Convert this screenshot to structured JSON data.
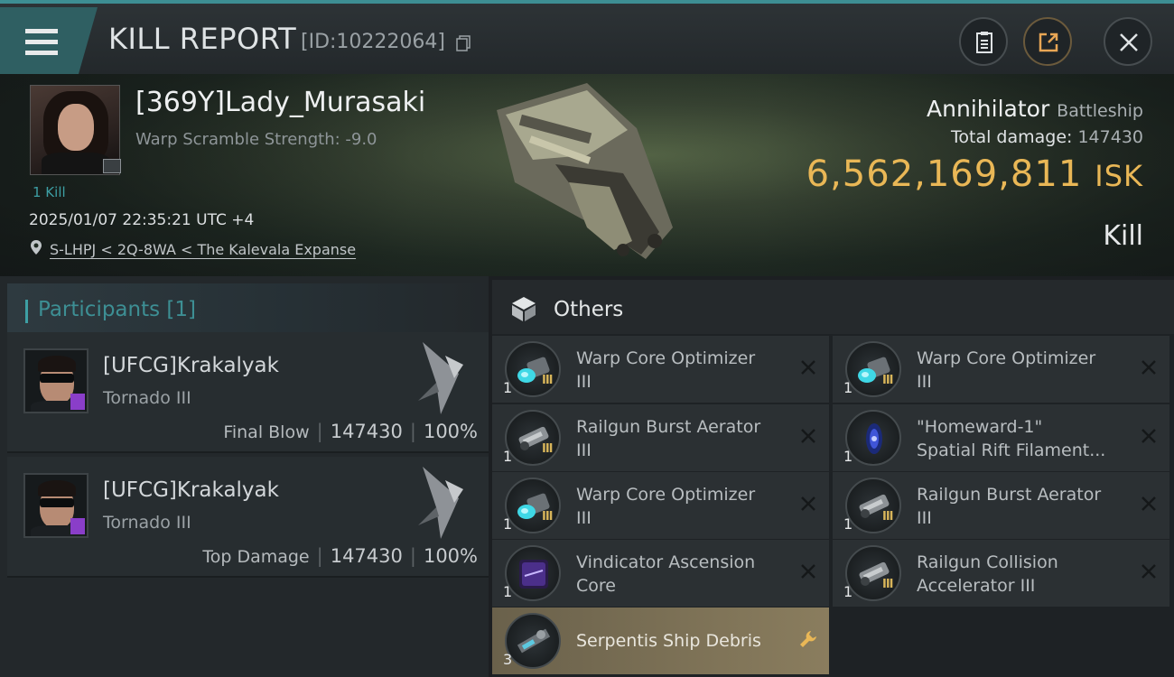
{
  "header": {
    "title": "KILL REPORT",
    "report_id": "[ID:10222064]",
    "icons": [
      "menu-icon",
      "copy-icon",
      "clipboard-icon",
      "share-icon",
      "close-icon"
    ],
    "accent_color": "#3d8e93"
  },
  "victim": {
    "name": "[369Y]Lady_Murasaki",
    "warp_scramble": "Warp Scramble Strength: -9.0",
    "kill_count": "1 Kill",
    "timestamp": "2025/01/07 22:35:21 UTC +4",
    "location": "S-LHPJ < 2Q-8WA < The Kalevala Expanse",
    "ship": "Annihilator",
    "ship_class": "Battleship",
    "total_damage_label": "Total damage:",
    "total_damage": "147430",
    "isk_value": "6,562,169,811",
    "isk_unit": "ISK",
    "result": "Kill",
    "isk_color": "#e9b756"
  },
  "participants": {
    "label": "Participants",
    "count": "[1]",
    "attackers": [
      {
        "name": "[UFCG]Krakalyak",
        "ship": "Tornado III",
        "role": "Final Blow",
        "damage": "147430",
        "percent": "100%"
      },
      {
        "name": "[UFCG]Krakalyak",
        "ship": "Tornado III",
        "role": "Top Damage",
        "damage": "147430",
        "percent": "100%"
      }
    ]
  },
  "others": {
    "label": "Others",
    "items": [
      {
        "line1": "Warp Core Optimizer",
        "line2": "III",
        "qty": "1",
        "tier": "III",
        "icon": "warp-core-icon",
        "status": "destroyed"
      },
      {
        "line1": "Warp Core Optimizer",
        "line2": "III",
        "qty": "1",
        "tier": "III",
        "icon": "warp-core-icon",
        "status": "destroyed"
      },
      {
        "line1": "Railgun Burst Aerator",
        "line2": "III",
        "qty": "1",
        "tier": "III",
        "icon": "railgun-icon",
        "status": "destroyed"
      },
      {
        "line1": "\"Homeward-1\"",
        "line2": "Spatial Rift Filament...",
        "qty": "1",
        "tier": "",
        "icon": "filament-icon",
        "status": "destroyed"
      },
      {
        "line1": "Warp Core Optimizer",
        "line2": "III",
        "qty": "1",
        "tier": "III",
        "icon": "warp-core-icon",
        "status": "destroyed"
      },
      {
        "line1": "Railgun Burst Aerator",
        "line2": "III",
        "qty": "1",
        "tier": "III",
        "icon": "railgun-icon",
        "status": "destroyed"
      },
      {
        "line1": "Vindicator Ascension",
        "line2": "Core",
        "qty": "1",
        "tier": "",
        "icon": "core-icon",
        "status": "destroyed"
      },
      {
        "line1": "Railgun Collision",
        "line2": "Accelerator III",
        "qty": "1",
        "tier": "III",
        "icon": "railgun-icon",
        "status": "destroyed"
      },
      {
        "line1": "Serpentis Ship Debris",
        "line2": "",
        "qty": "3",
        "tier": "",
        "icon": "debris-icon",
        "status": "dropped"
      }
    ]
  }
}
